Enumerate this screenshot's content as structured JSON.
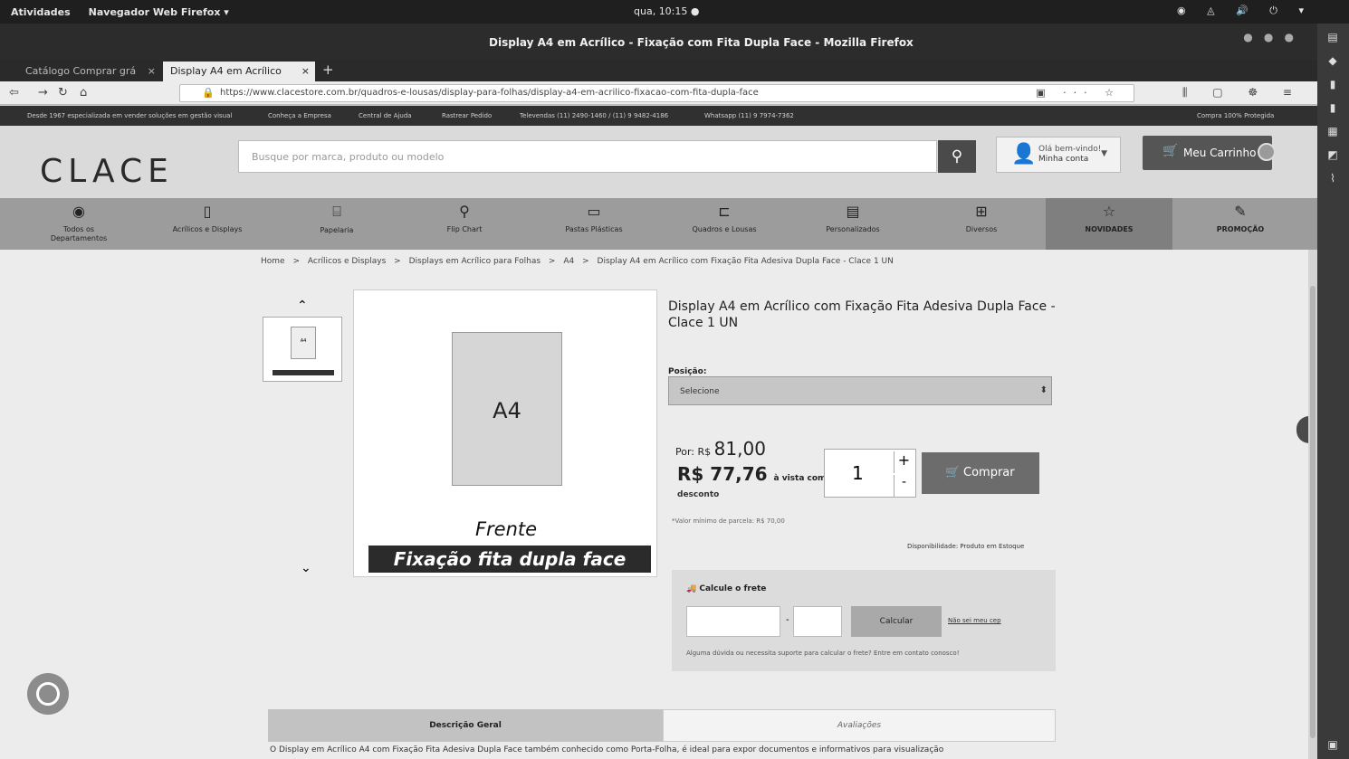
{
  "gnome": {
    "activities": "Atividades",
    "app_menu": "Navegador Web Firefox ▾",
    "clock": "qua, 10:15 ●",
    "tray": "◉ ◬ 🔊 ⏻ ▾"
  },
  "window": {
    "title": "Display A4 em Acrílico - Fixação com Fita Dupla Face - Mozilla Firefox"
  },
  "tabs": [
    {
      "label": "Catálogo Comprar grá",
      "active": false
    },
    {
      "label": "Display A4 em Acrílico",
      "active": true
    }
  ],
  "url": "https://www.clacestore.com.br/quadros-e-lousas/display-para-folhas/display-a4-em-acrilico-fixacao-com-fita-dupla-face",
  "infobar": [
    "Desde 1967 especializada em vender soluções em gestão visual",
    "Conheça a Empresa",
    "Central de Ajuda",
    "Rastrear Pedido",
    "Televendas (11) 2490-1460 / (11) 9 9482-4186",
    "Whatsapp (11) 9 7974-7362",
    "Compra 100% Protegida"
  ],
  "header": {
    "logo": "CLACE",
    "search_placeholder": "Busque por marca, produto ou modelo",
    "account_line1": "Olá bem-vindo!",
    "account_line2": "Minha conta",
    "cart_label": "Meu Carrinho"
  },
  "categories": [
    {
      "label": "Todos os Departamentos",
      "icon": "◉"
    },
    {
      "label": "Acrílicos e Displays",
      "icon": "▯"
    },
    {
      "label": "Papelaria",
      "icon": "⌸"
    },
    {
      "label": "Flip Chart",
      "icon": "⚲"
    },
    {
      "label": "Pastas Plásticas",
      "icon": "▭"
    },
    {
      "label": "Quadros e Lousas",
      "icon": "⊏"
    },
    {
      "label": "Personalizados",
      "icon": "▤"
    },
    {
      "label": "Diversos",
      "icon": "⊞"
    },
    {
      "label": "NOVIDADES",
      "icon": "☆"
    },
    {
      "label": "PROMOÇÃO",
      "icon": "✎"
    }
  ],
  "breadcrumb": [
    "Home",
    ">",
    "Acrílicos e Displays",
    ">",
    "Displays em Acrílico para Folhas",
    ">",
    "A4",
    ">",
    "Display A4 em Acrílico com Fixação Fita Adesiva Dupla Face - Clace 1 UN"
  ],
  "product": {
    "title": "Display A4 em Acrílico com Fixação Fita Adesiva Dupla Face - Clace 1 UN",
    "image_sheet_label": "A4",
    "image_caption_top": "Frente",
    "image_caption_band": "Fixação fita dupla face",
    "position_label": "Posição:",
    "position_value": "Selecione",
    "price_prefix": "Por: R$",
    "price": "81,00",
    "price_cash": "R$ 77,76",
    "price_cash_suffix": "à vista com",
    "price_cash_suffix2": "desconto",
    "price_note": "*Valor mínimo de parcela: R$ 70,00",
    "quantity": "1",
    "buy_label": "Comprar",
    "availability": "Disponibilidade: Produto em Estoque"
  },
  "shipping": {
    "heading": "Calcule o frete",
    "calc_button": "Calcular",
    "unknown_cep": "Não sei meu cep",
    "help": "Alguma dúvida ou necessita suporte para calcular o frete? Entre em contato conosco!"
  },
  "desc_tabs": {
    "general": "Descrição Geral",
    "reviews": "Avaliações"
  },
  "desc_text": "O Display em Acrílico A4 com Fixação Fita Adesiva Dupla Face também conhecido como Porta-Folha, é ideal para expor documentos e informativos para visualização"
}
